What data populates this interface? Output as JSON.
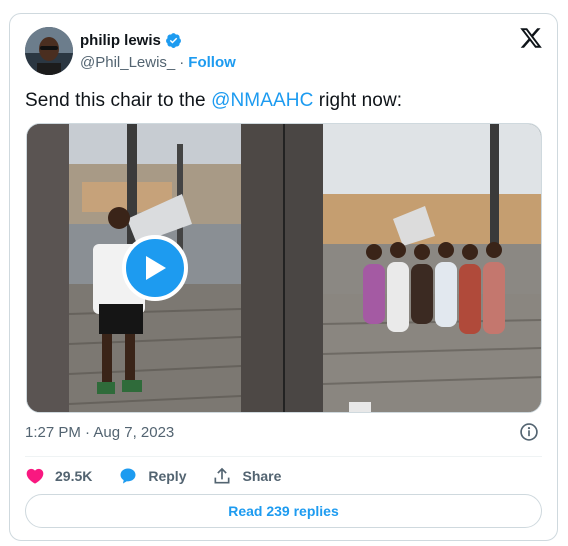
{
  "author": {
    "display_name": "philip lewis",
    "handle": "@Phil_Lewis_",
    "separator": "·",
    "follow_label": "Follow"
  },
  "tweet": {
    "text_before": "Send this chair to the ",
    "mention": "@NMAAHC",
    "text_after": " right now:"
  },
  "meta": {
    "timestamp": "1:27 PM · Aug 7, 2023"
  },
  "actions": {
    "likes": "29.5K",
    "reply_label": "Reply",
    "share_label": "Share"
  },
  "replies_button": "Read 239 replies",
  "colors": {
    "accent": "#1d9bf0",
    "like": "#f91880",
    "text": "#0f1419",
    "muted": "#536471"
  }
}
